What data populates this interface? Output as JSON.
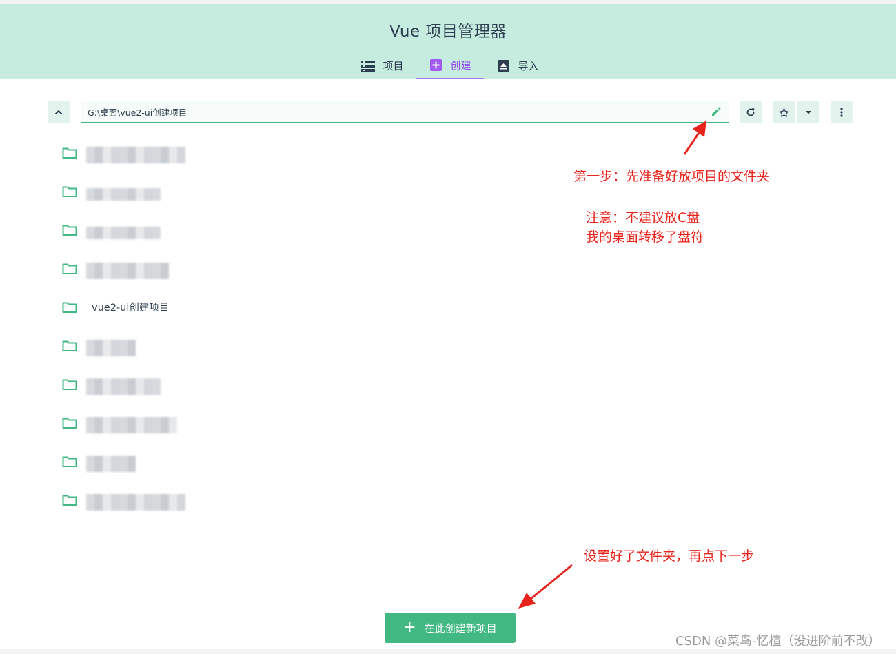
{
  "app": {
    "title": "Vue 项目管理器"
  },
  "tabs": [
    {
      "label": "项目",
      "icon": "list-icon",
      "active": false
    },
    {
      "label": "创建",
      "icon": "plus-box-icon",
      "active": true
    },
    {
      "label": "导入",
      "icon": "upload-box-icon",
      "active": false
    }
  ],
  "path": {
    "value": "G:\\桌面\\vue2-ui创建项目"
  },
  "folders": [
    {
      "label": "",
      "blurred": true
    },
    {
      "label": "",
      "blurred": true
    },
    {
      "label": "",
      "blurred": true
    },
    {
      "label": "",
      "blurred": true
    },
    {
      "label": "vue2-ui创建项目",
      "blurred": false
    },
    {
      "label": "",
      "blurred": true
    },
    {
      "label": "",
      "blurred": true
    },
    {
      "label": "",
      "blurred": true
    },
    {
      "label": "",
      "blurred": true
    },
    {
      "label": "",
      "blurred": true
    }
  ],
  "annotations": {
    "step1": "第一步：先准备好放项目的文件夹",
    "warning_line1": "注意：不建议放C盘",
    "warning_line2": "我的桌面转移了盘符",
    "next": "设置好了文件夹，再点下一步"
  },
  "create_button": {
    "label": "在此创建新项目"
  },
  "watermark": "CSDN @菜鸟-忆楦（没进阶前不改）",
  "colors": {
    "header_bg": "#c6ebdf",
    "accent_green": "#42b883",
    "active_tab": "#8e44ed",
    "annotation_red": "#e8231b"
  }
}
